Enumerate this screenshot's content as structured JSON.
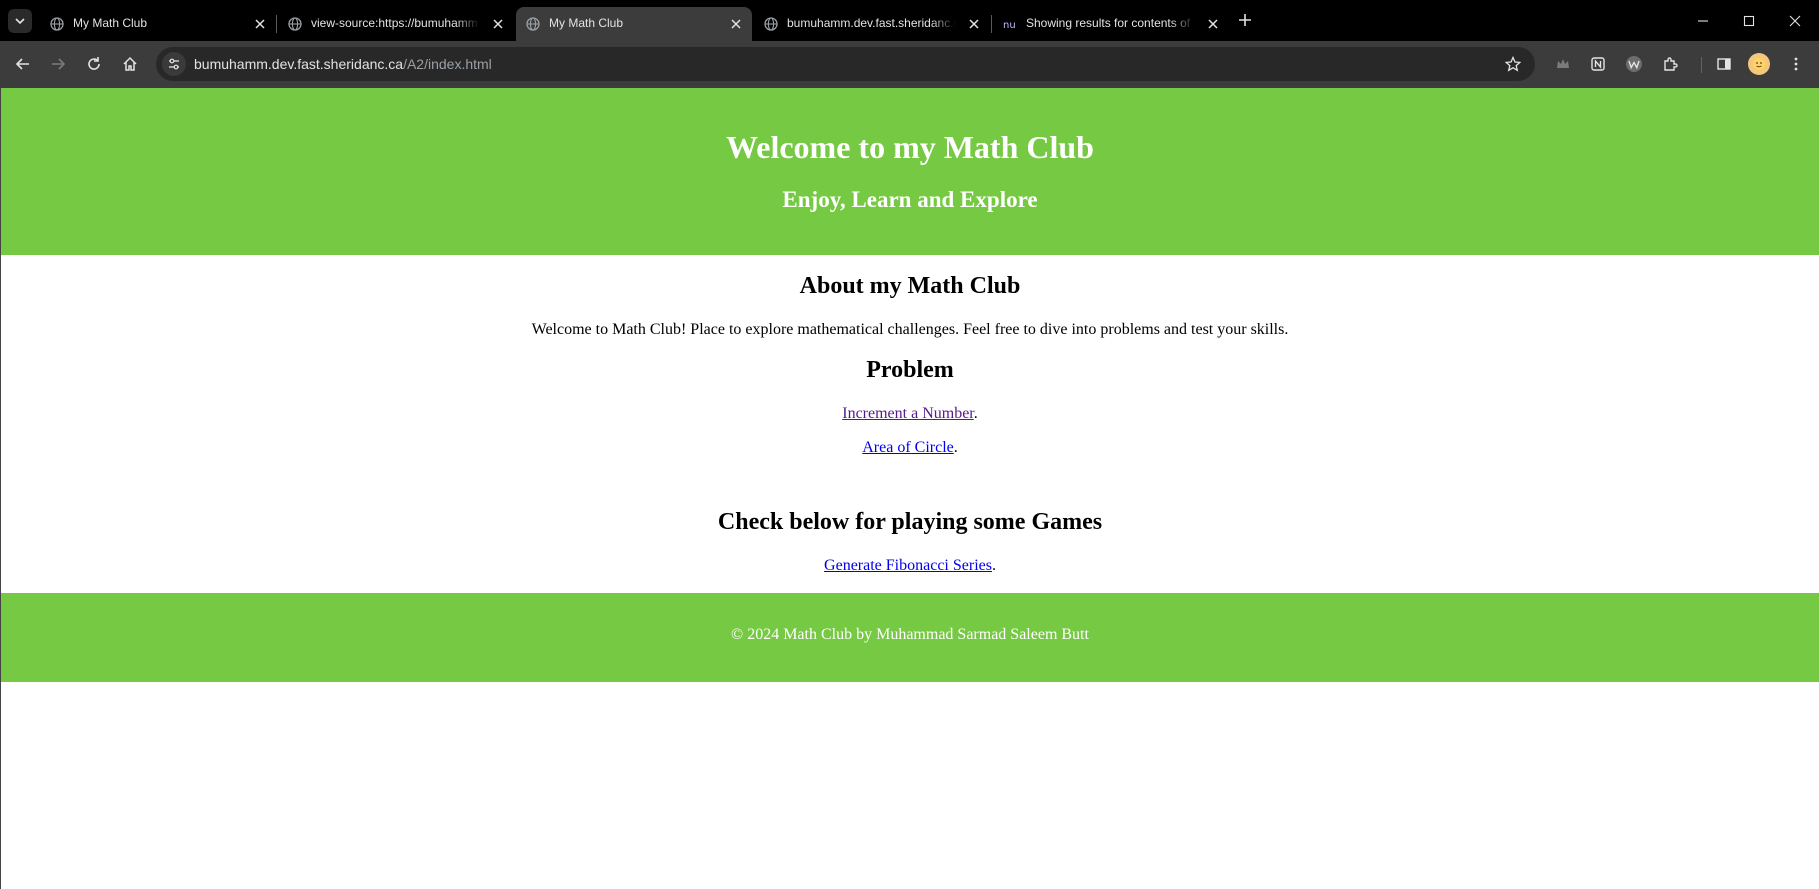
{
  "browser": {
    "tabs": [
      {
        "title": "My Math Club",
        "active": false
      },
      {
        "title": "view-source:https://bumuhamm",
        "active": false
      },
      {
        "title": "My Math Club",
        "active": true
      },
      {
        "title": "bumuhamm.dev.fast.sheridanc.ca",
        "active": false
      },
      {
        "title": "Showing results for contents of",
        "active": false
      }
    ],
    "url_host": "bumuhamm.dev.fast.sheridanc.ca",
    "url_path": "/A2/index.html",
    "icons": [
      "tab-list-icon",
      "globe-icon",
      "close-icon",
      "plus-icon",
      "minimize-icon",
      "maximize-icon",
      "back-icon",
      "forward-icon",
      "reload-icon",
      "home-icon",
      "site-info-icon",
      "star-icon",
      "extension-icon",
      "side-panel-icon",
      "menu-icon"
    ],
    "colors": {
      "frame": "#000000",
      "toolbar": "#3c3c3c",
      "omnibox": "#282828"
    }
  },
  "page": {
    "header": {
      "title": "Welcome to my Math Club",
      "subtitle": "Enjoy, Learn and Explore"
    },
    "about": {
      "heading": "About my Math Club",
      "text": "Welcome to Math Club! Place to explore mathematical challenges. Feel free to dive into problems and test your skills."
    },
    "problem": {
      "heading": "Problem",
      "links": [
        {
          "label": "Increment a Number",
          "suffix": ".",
          "visited": true
        },
        {
          "label": "Area of Circle",
          "suffix": ".",
          "visited": false
        }
      ]
    },
    "games": {
      "heading": "Check below for playing some Games",
      "link": {
        "label": "Generate Fibonacci Series",
        "suffix": "."
      }
    },
    "footer": {
      "text": "© 2024 Math Club by Muhammad Sarmad Saleem Butt"
    },
    "colors": {
      "accent_green": "#76c942",
      "link": "#0000ee",
      "link_visited": "#551a8b"
    }
  }
}
